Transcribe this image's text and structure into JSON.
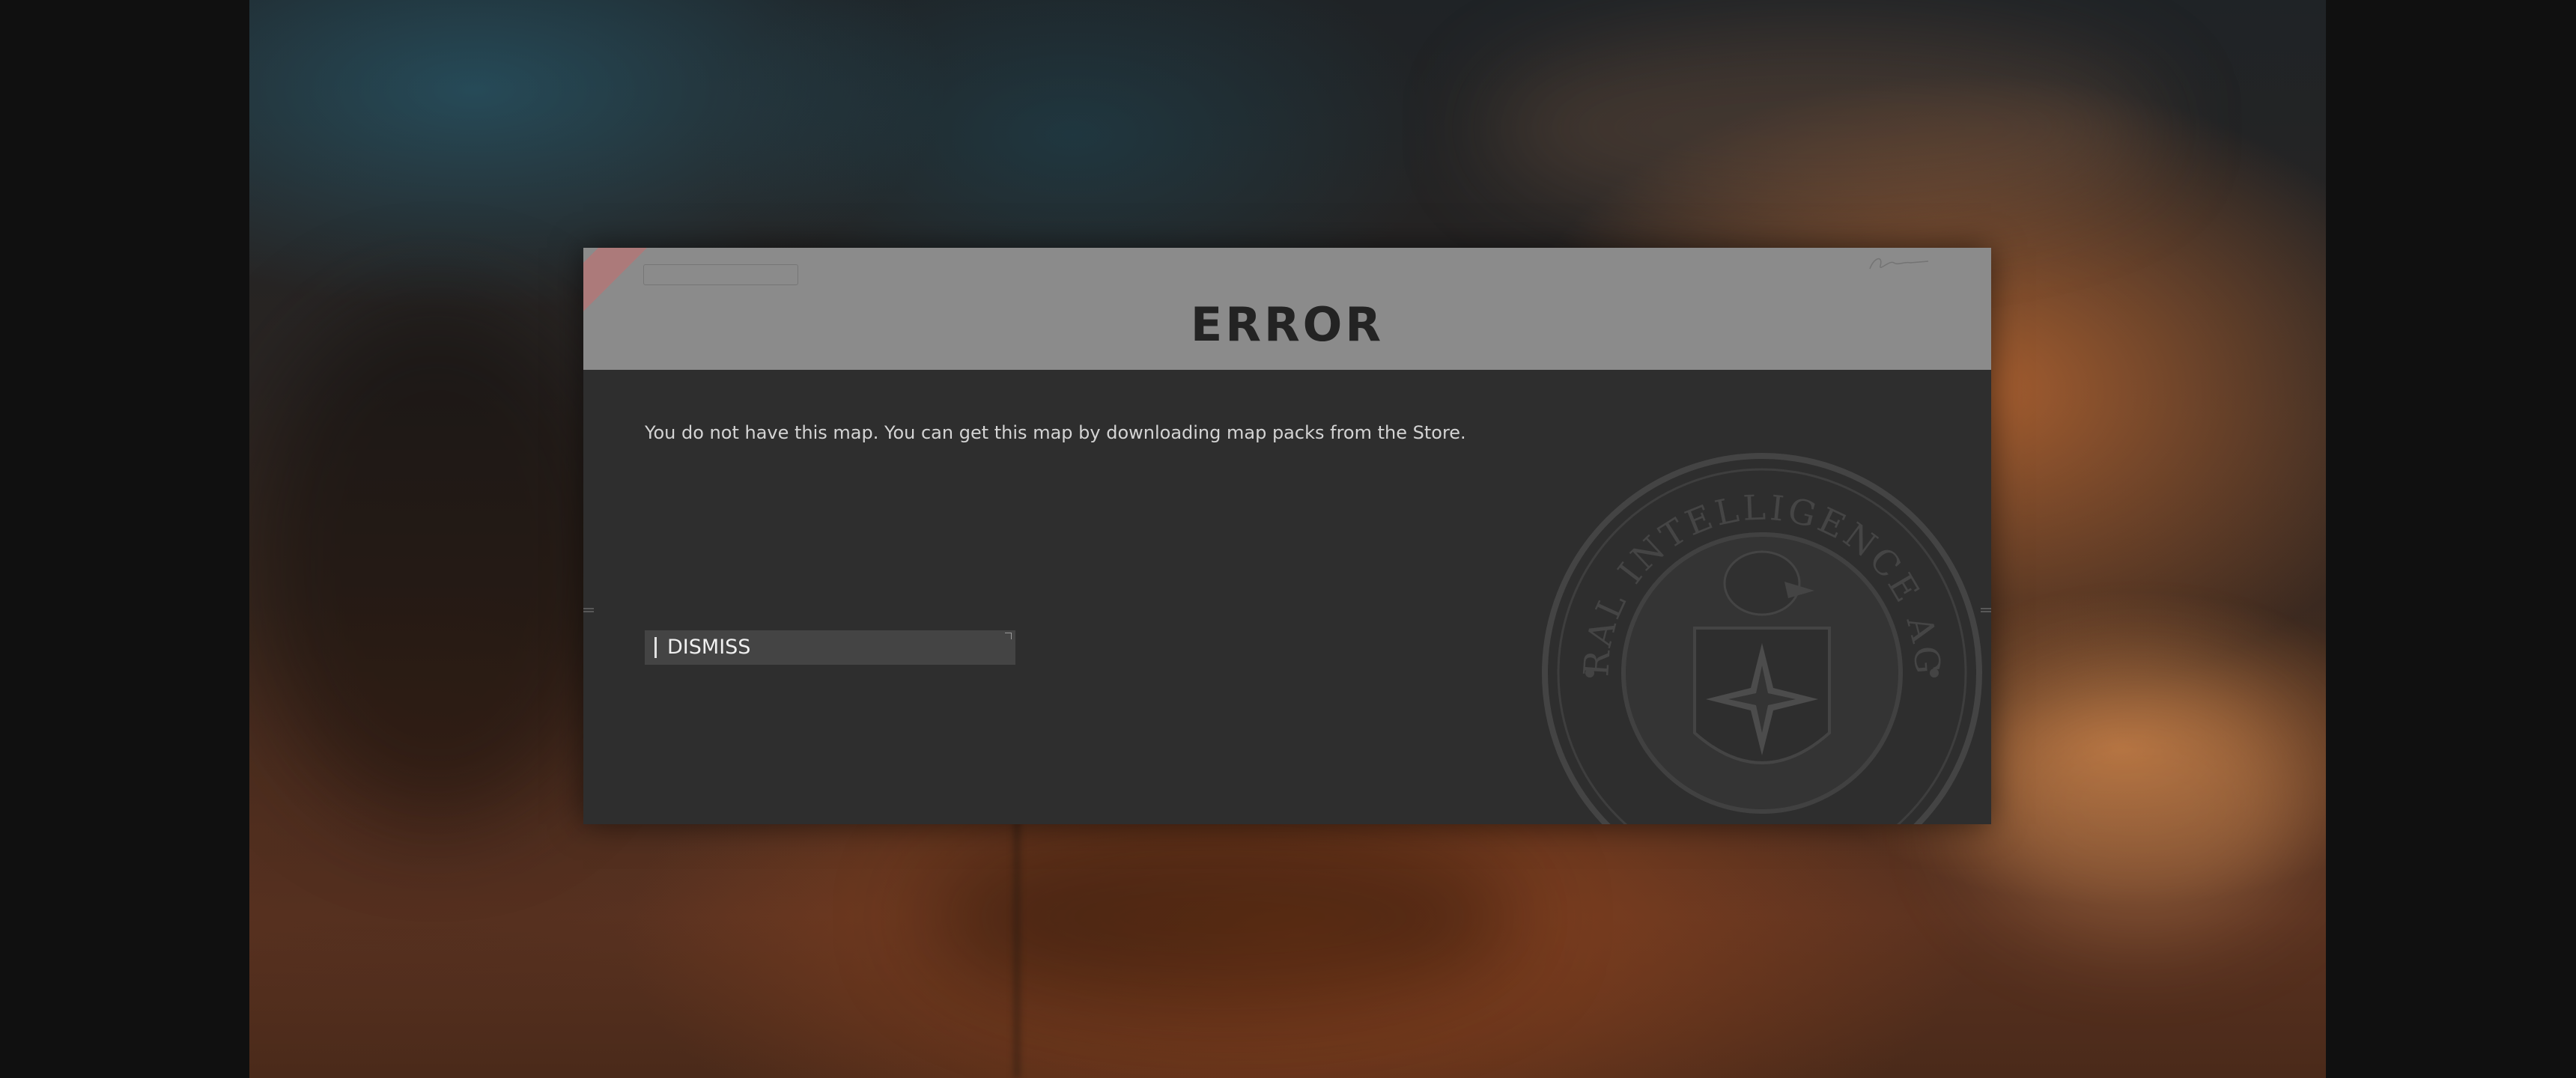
{
  "dialog": {
    "title": "ERROR",
    "message": "You do not have this map. You can get this map by downloading map packs from the Store.",
    "dismiss_label": "DISMISS",
    "header_tag": "",
    "header_right": "",
    "footer_left": "",
    "footer_mid": "",
    "footer_right": ""
  },
  "emblem": {
    "icon": "cia-seal-icon",
    "text": "CENTRAL INTELLIGENCE AGENCY"
  },
  "colors": {
    "header_bg": "#8b8b8b",
    "body_bg": "#2e2e2e",
    "button_bg": "#444444",
    "title_text": "#232323",
    "message_text": "#d4d4d4"
  }
}
